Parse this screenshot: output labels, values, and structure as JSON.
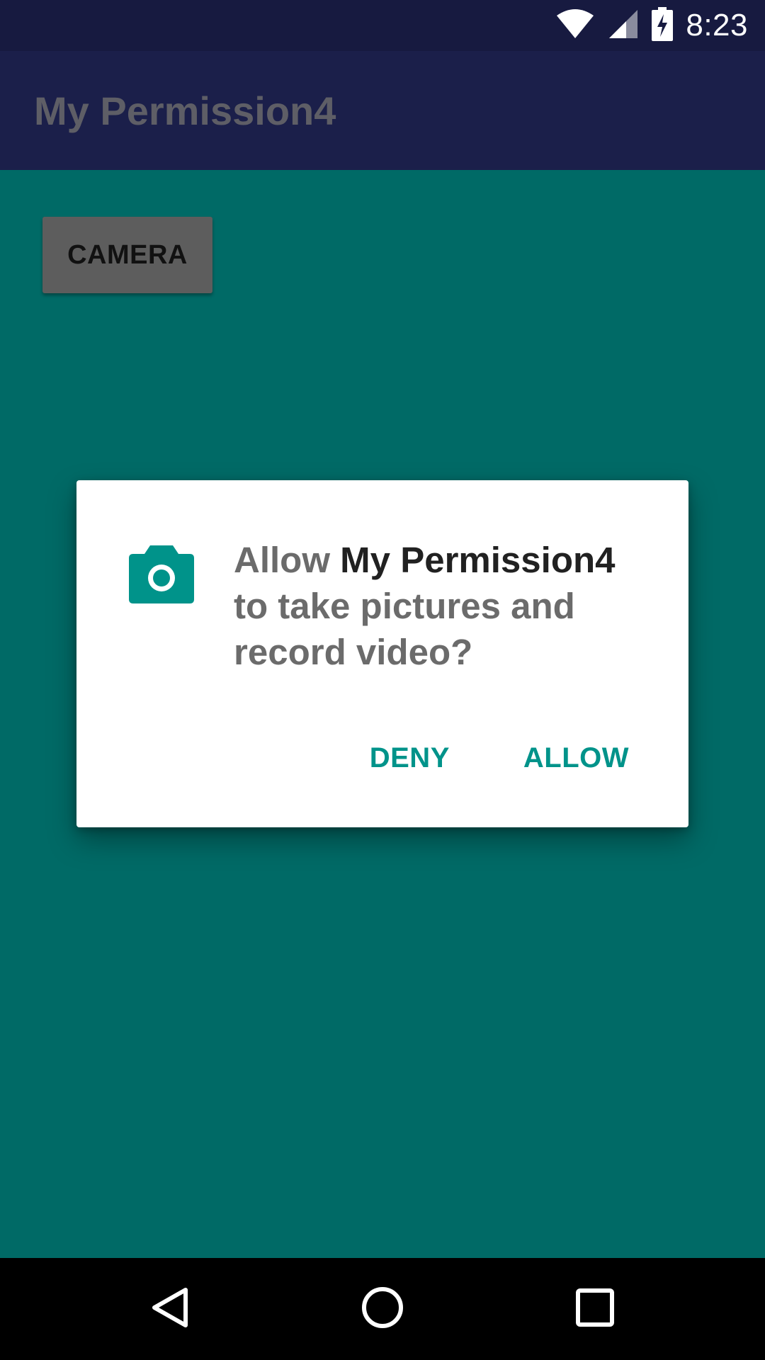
{
  "status_bar": {
    "time": "8:23",
    "icons": [
      "wifi-icon",
      "cell-signal-icon",
      "battery-charging-icon"
    ]
  },
  "app_bar": {
    "title": "My Permission4"
  },
  "main": {
    "camera_button_label": "CAMERA"
  },
  "dialog": {
    "icon": "camera-icon",
    "message_prefix": "Allow ",
    "app_name": "My Permission4",
    "message_suffix": " to take pictures and record video?",
    "deny_label": "DENY",
    "allow_label": "ALLOW"
  },
  "nav_bar": {
    "icons": [
      "back-icon",
      "home-icon",
      "recents-icon"
    ]
  },
  "colors": {
    "status_bar": "#171a40",
    "app_bar": "#1b1f4a",
    "background_dim": "#006a66",
    "accent": "#00938a"
  }
}
